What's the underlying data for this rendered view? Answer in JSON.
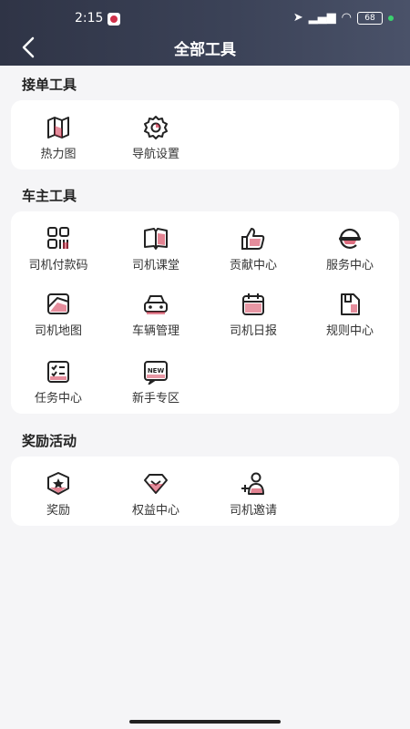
{
  "status_bar": {
    "time": "2:15",
    "battery": "68"
  },
  "header": {
    "title": "全部工具"
  },
  "sections": [
    {
      "title": "接单工具",
      "items": [
        {
          "label": "热力图",
          "icon": "heatmap-map-icon"
        },
        {
          "label": "导航设置",
          "icon": "gear-icon"
        }
      ]
    },
    {
      "title": "车主工具",
      "items": [
        {
          "label": "司机付款码",
          "icon": "qr-code-icon"
        },
        {
          "label": "司机课堂",
          "icon": "open-book-icon"
        },
        {
          "label": "贡献中心",
          "icon": "thumbs-up-icon"
        },
        {
          "label": "服务中心",
          "icon": "headset-icon"
        },
        {
          "label": "司机地图",
          "icon": "map-icon"
        },
        {
          "label": "车辆管理",
          "icon": "car-icon"
        },
        {
          "label": "司机日报",
          "icon": "calendar-icon"
        },
        {
          "label": "规则中心",
          "icon": "document-icon"
        },
        {
          "label": "任务中心",
          "icon": "checklist-icon"
        },
        {
          "label": "新手专区",
          "icon": "new-badge-icon",
          "badge": "NEW"
        }
      ]
    },
    {
      "title": "奖励活动",
      "items": [
        {
          "label": "奖励",
          "icon": "star-badge-icon"
        },
        {
          "label": "权益中心",
          "icon": "diamond-icon"
        },
        {
          "label": "司机邀请",
          "icon": "invite-user-icon"
        }
      ]
    }
  ],
  "colors": {
    "accent": "#d0304a",
    "header_dark": "#2f3446",
    "icon_stroke": "#222222"
  }
}
